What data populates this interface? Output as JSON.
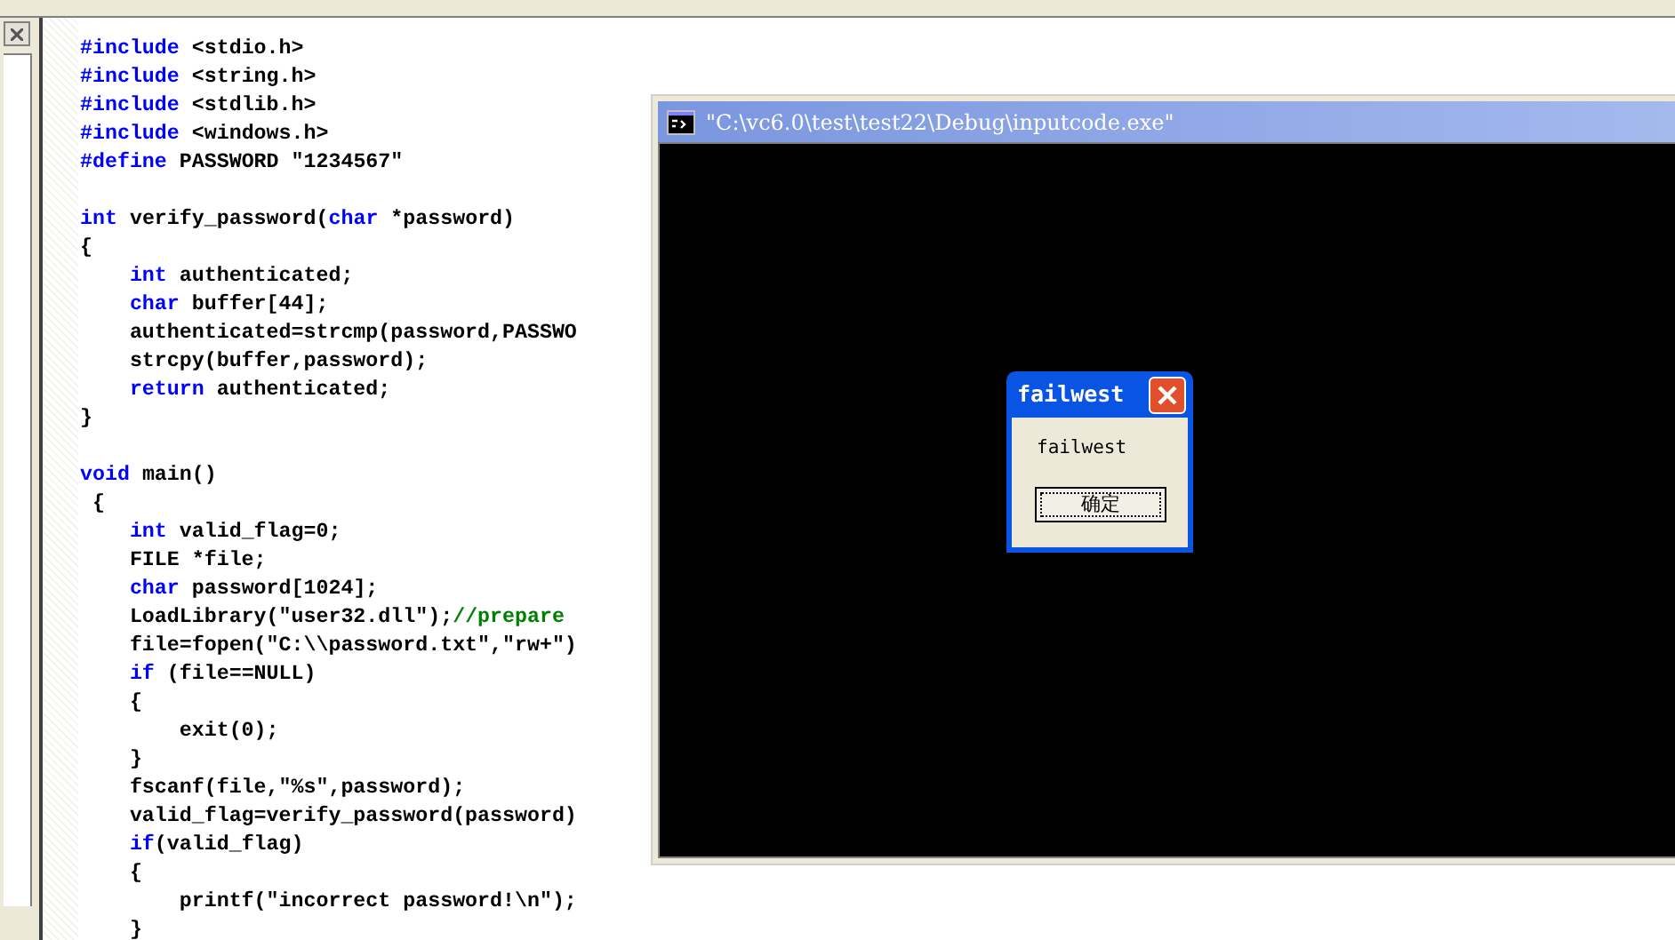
{
  "editor": {
    "lines": [
      {
        "kind": "code",
        "tokens": [
          {
            "kind": "keyword",
            "text": "#include"
          },
          {
            "kind": "plain",
            "text": " <stdio.h>"
          }
        ]
      },
      {
        "kind": "code",
        "tokens": [
          {
            "kind": "keyword",
            "text": "#include"
          },
          {
            "kind": "plain",
            "text": " <string.h>"
          }
        ]
      },
      {
        "kind": "code",
        "tokens": [
          {
            "kind": "keyword",
            "text": "#include"
          },
          {
            "kind": "plain",
            "text": " <stdlib.h>"
          }
        ]
      },
      {
        "kind": "code",
        "tokens": [
          {
            "kind": "keyword",
            "text": "#include"
          },
          {
            "kind": "plain",
            "text": " <windows.h>"
          }
        ]
      },
      {
        "kind": "code",
        "tokens": [
          {
            "kind": "keyword",
            "text": "#define"
          },
          {
            "kind": "plain",
            "text": " PASSWORD \"1234567\""
          }
        ]
      },
      {
        "kind": "blank"
      },
      {
        "kind": "code",
        "tokens": [
          {
            "kind": "keyword",
            "text": "int"
          },
          {
            "kind": "plain",
            "text": " verify_password("
          },
          {
            "kind": "keyword",
            "text": "char"
          },
          {
            "kind": "plain",
            "text": " *password)"
          }
        ]
      },
      {
        "kind": "code",
        "tokens": [
          {
            "kind": "plain",
            "text": "{"
          }
        ]
      },
      {
        "kind": "code",
        "tokens": [
          {
            "kind": "keyword",
            "text": "    int"
          },
          {
            "kind": "plain",
            "text": " authenticated;"
          }
        ]
      },
      {
        "kind": "code",
        "tokens": [
          {
            "kind": "keyword",
            "text": "    char"
          },
          {
            "kind": "plain",
            "text": " buffer[44];"
          }
        ]
      },
      {
        "kind": "code",
        "tokens": [
          {
            "kind": "plain",
            "text": "    authenticated=strcmp(password,PASSWO"
          }
        ]
      },
      {
        "kind": "code",
        "tokens": [
          {
            "kind": "plain",
            "text": "    strcpy(buffer,password);"
          }
        ]
      },
      {
        "kind": "code",
        "tokens": [
          {
            "kind": "keyword",
            "text": "    return"
          },
          {
            "kind": "plain",
            "text": " authenticated;"
          }
        ]
      },
      {
        "kind": "code",
        "tokens": [
          {
            "kind": "plain",
            "text": "}"
          }
        ]
      },
      {
        "kind": "blank"
      },
      {
        "kind": "code",
        "tokens": [
          {
            "kind": "keyword",
            "text": "void"
          },
          {
            "kind": "plain",
            "text": " main()"
          }
        ]
      },
      {
        "kind": "code",
        "tokens": [
          {
            "kind": "plain",
            "text": " {"
          }
        ]
      },
      {
        "kind": "code",
        "tokens": [
          {
            "kind": "keyword",
            "text": "    int"
          },
          {
            "kind": "plain",
            "text": " valid_flag=0;"
          }
        ]
      },
      {
        "kind": "code",
        "tokens": [
          {
            "kind": "plain",
            "text": "    FILE *file;"
          }
        ]
      },
      {
        "kind": "code",
        "tokens": [
          {
            "kind": "keyword",
            "text": "    char"
          },
          {
            "kind": "plain",
            "text": " password[1024];"
          }
        ]
      },
      {
        "kind": "code",
        "tokens": [
          {
            "kind": "plain",
            "text": "    LoadLibrary(\"user32.dll\");"
          },
          {
            "kind": "comment",
            "text": "//prepare"
          }
        ]
      },
      {
        "kind": "code",
        "tokens": [
          {
            "kind": "plain",
            "text": "    file=fopen(\"C:\\\\password.txt\",\"rw+\")"
          }
        ]
      },
      {
        "kind": "code",
        "tokens": [
          {
            "kind": "keyword",
            "text": "    if"
          },
          {
            "kind": "plain",
            "text": " (file==NULL)"
          }
        ]
      },
      {
        "kind": "code",
        "tokens": [
          {
            "kind": "plain",
            "text": "    {"
          }
        ]
      },
      {
        "kind": "code",
        "tokens": [
          {
            "kind": "plain",
            "text": "        exit(0);"
          }
        ]
      },
      {
        "kind": "code",
        "tokens": [
          {
            "kind": "plain",
            "text": "    }"
          }
        ]
      },
      {
        "kind": "code",
        "tokens": [
          {
            "kind": "plain",
            "text": "    fscanf(file,\"%s\",password);"
          }
        ]
      },
      {
        "kind": "code",
        "tokens": [
          {
            "kind": "plain",
            "text": "    valid_flag=verify_password(password)"
          }
        ]
      },
      {
        "kind": "code",
        "tokens": [
          {
            "kind": "keyword",
            "text": "    if"
          },
          {
            "kind": "plain",
            "text": "(valid_flag)"
          }
        ]
      },
      {
        "kind": "code",
        "tokens": [
          {
            "kind": "plain",
            "text": "    {"
          }
        ]
      },
      {
        "kind": "code",
        "tokens": [
          {
            "kind": "plain",
            "text": "        printf(\"incorrect password!\\n\");"
          }
        ]
      },
      {
        "kind": "code",
        "tokens": [
          {
            "kind": "plain",
            "text": "    }"
          }
        ]
      }
    ]
  },
  "console": {
    "title": "\"C:\\vc6.0\\test\\test22\\Debug\\inputcode.exe\""
  },
  "dialog": {
    "title": "failwest",
    "message": "failwest",
    "button": "确定"
  }
}
